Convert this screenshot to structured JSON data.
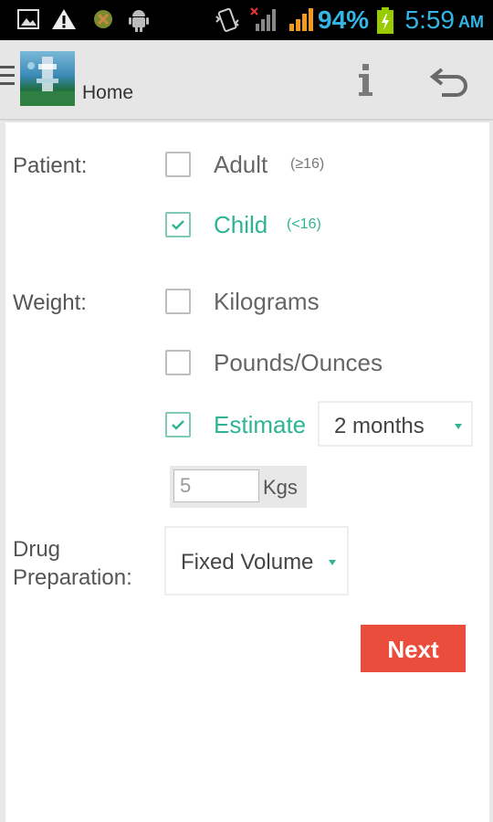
{
  "statusbar": {
    "battery_pct": "94%",
    "time": "5:59",
    "ampm": "AM",
    "icons": [
      "gallery-icon",
      "warning-icon",
      "android-debug-icon",
      "android-icon",
      "vibrate-icon",
      "no-signal-icon",
      "signal-icon",
      "battery-charging-icon"
    ]
  },
  "actionbar": {
    "title": "Home",
    "icons": [
      "menu-icon",
      "app-logo",
      "info-icon",
      "back-icon"
    ]
  },
  "form": {
    "patient_label": "Patient:",
    "patient_options": [
      {
        "label": "Adult",
        "hint": "(≥16)",
        "checked": false
      },
      {
        "label": "Child",
        "hint": "(<16)",
        "checked": true
      }
    ],
    "weight_label": "Weight:",
    "weight_options": [
      {
        "label": "Kilograms",
        "checked": false
      },
      {
        "label": "Pounds/Ounces",
        "checked": false
      },
      {
        "label": "Estimate",
        "checked": true
      }
    ],
    "estimate_age": "2 months",
    "estimate_weight_value": "5",
    "estimate_weight_unit": "Kgs",
    "drug_label_line1": "Drug",
    "drug_label_line2": "Preparation:",
    "drug_preparation": "Fixed Volume",
    "next_button": "Next"
  },
  "colors": {
    "accent": "#2fb493",
    "button": "#ea4d3c",
    "status_text": "#33b5e5"
  }
}
